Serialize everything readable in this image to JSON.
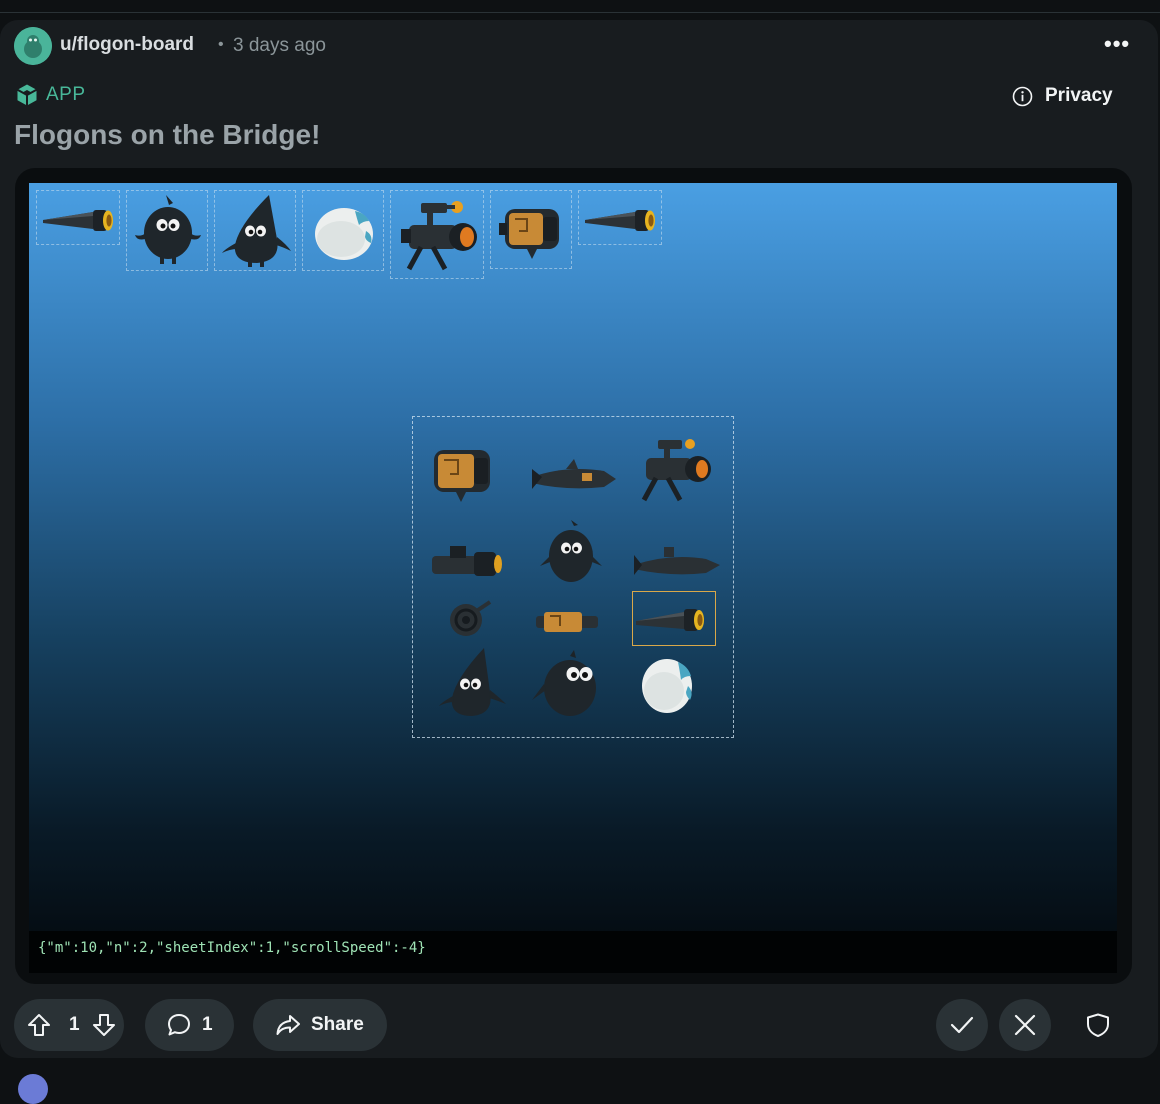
{
  "post": {
    "username": "u/flogon-board",
    "separator": "•",
    "time_ago": "3 days ago",
    "more_label": "•••",
    "app_badge": "APP",
    "privacy_label": "Privacy",
    "title": "Flogons on the Bridge!"
  },
  "game": {
    "top_row_sprites": [
      "telescope",
      "flogon-round",
      "flogon-pointy",
      "egg",
      "cannon-rig",
      "barrel-pod",
      "telescope"
    ],
    "grid_sprites": [
      [
        "barrel-pod",
        "rocket",
        "cannon-rig"
      ],
      [
        "gun-barrel",
        "flogon-tall",
        "submarine"
      ],
      [
        "spiral-shell",
        "barrel-pod-small",
        "telescope"
      ],
      [
        "flogon-pointy",
        "flogon-round",
        "egg"
      ]
    ],
    "selected_sprite": "telescope",
    "debug_text": "{\"m\":10,\"n\":2,\"sheetIndex\":1,\"scrollSpeed\":-4}"
  },
  "actions": {
    "upvote_count": "1",
    "comment_count": "1",
    "share_label": "Share"
  },
  "colors": {
    "background": "#0e1113",
    "card": "#181c1f",
    "accent_green": "#48b899",
    "button": "#2a3236",
    "selection": "#d9a849"
  }
}
